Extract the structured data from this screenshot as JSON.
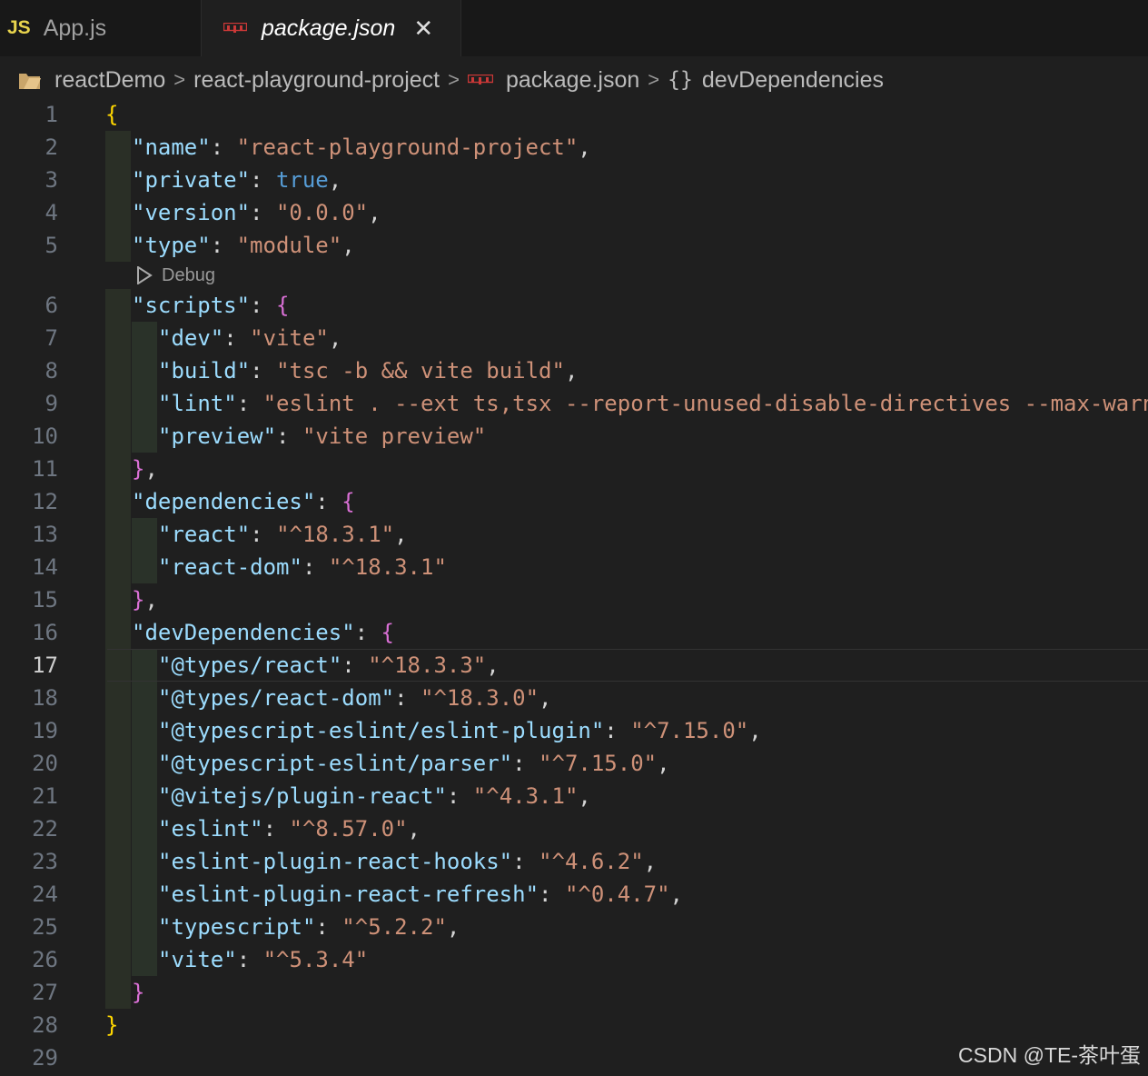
{
  "tabs": [
    {
      "badge": "JS",
      "label": "App.js"
    },
    {
      "label": "package.json",
      "close": "✕"
    }
  ],
  "breadcrumb": {
    "items": [
      "reactDemo",
      "react-playground-project",
      "package.json",
      "devDependencies"
    ],
    "separator": ">",
    "braces": "{}"
  },
  "codelens": {
    "label": "Debug"
  },
  "lines": [
    {
      "n": "1",
      "tokens": [
        [
          "br1",
          "{"
        ]
      ]
    },
    {
      "n": "2",
      "tokens": [
        [
          "k",
          "\"name\""
        ],
        [
          "p",
          ": "
        ],
        [
          "s",
          "\"react-playground-project\""
        ],
        [
          "p",
          ","
        ]
      ]
    },
    {
      "n": "3",
      "tokens": [
        [
          "k",
          "\"private\""
        ],
        [
          "p",
          ": "
        ],
        [
          "b",
          "true"
        ],
        [
          "p",
          ","
        ]
      ]
    },
    {
      "n": "4",
      "tokens": [
        [
          "k",
          "\"version\""
        ],
        [
          "p",
          ": "
        ],
        [
          "s",
          "\"0.0.0\""
        ],
        [
          "p",
          ","
        ]
      ]
    },
    {
      "n": "5",
      "tokens": [
        [
          "k",
          "\"type\""
        ],
        [
          "p",
          ": "
        ],
        [
          "s",
          "\"module\""
        ],
        [
          "p",
          ","
        ]
      ]
    },
    {
      "n": "6",
      "tokens": [
        [
          "k",
          "\"scripts\""
        ],
        [
          "p",
          ": "
        ],
        [
          "br2",
          "{"
        ]
      ]
    },
    {
      "n": "7",
      "tokens": [
        [
          "k",
          "\"dev\""
        ],
        [
          "p",
          ": "
        ],
        [
          "s",
          "\"vite\""
        ],
        [
          "p",
          ","
        ]
      ]
    },
    {
      "n": "8",
      "tokens": [
        [
          "k",
          "\"build\""
        ],
        [
          "p",
          ": "
        ],
        [
          "s",
          "\"tsc -b && vite build\""
        ],
        [
          "p",
          ","
        ]
      ]
    },
    {
      "n": "9",
      "tokens": [
        [
          "k",
          "\"lint\""
        ],
        [
          "p",
          ": "
        ],
        [
          "s",
          "\"eslint . --ext ts,tsx --report-unused-disable-directives --max-warn"
        ]
      ]
    },
    {
      "n": "10",
      "tokens": [
        [
          "k",
          "\"preview\""
        ],
        [
          "p",
          ": "
        ],
        [
          "s",
          "\"vite preview\""
        ]
      ]
    },
    {
      "n": "11",
      "tokens": [
        [
          "br2",
          "}"
        ],
        [
          "p",
          ","
        ]
      ]
    },
    {
      "n": "12",
      "tokens": [
        [
          "k",
          "\"dependencies\""
        ],
        [
          "p",
          ": "
        ],
        [
          "br2",
          "{"
        ]
      ]
    },
    {
      "n": "13",
      "tokens": [
        [
          "k",
          "\"react\""
        ],
        [
          "p",
          ": "
        ],
        [
          "s",
          "\"^18.3.1\""
        ],
        [
          "p",
          ","
        ]
      ]
    },
    {
      "n": "14",
      "tokens": [
        [
          "k",
          "\"react-dom\""
        ],
        [
          "p",
          ": "
        ],
        [
          "s",
          "\"^18.3.1\""
        ]
      ]
    },
    {
      "n": "15",
      "tokens": [
        [
          "br2",
          "}"
        ],
        [
          "p",
          ","
        ]
      ]
    },
    {
      "n": "16",
      "tokens": [
        [
          "k",
          "\"devDependencies\""
        ],
        [
          "p",
          ": "
        ],
        [
          "br2",
          "{"
        ]
      ]
    },
    {
      "n": "17",
      "tokens": [
        [
          "k",
          "\"@types/react\""
        ],
        [
          "p",
          ": "
        ],
        [
          "s",
          "\"^18.3.3\""
        ],
        [
          "p",
          ","
        ]
      ]
    },
    {
      "n": "18",
      "tokens": [
        [
          "k",
          "\"@types/react-dom\""
        ],
        [
          "p",
          ": "
        ],
        [
          "s",
          "\"^18.3.0\""
        ],
        [
          "p",
          ","
        ]
      ]
    },
    {
      "n": "19",
      "tokens": [
        [
          "k",
          "\"@typescript-eslint/eslint-plugin\""
        ],
        [
          "p",
          ": "
        ],
        [
          "s",
          "\"^7.15.0\""
        ],
        [
          "p",
          ","
        ]
      ]
    },
    {
      "n": "20",
      "tokens": [
        [
          "k",
          "\"@typescript-eslint/parser\""
        ],
        [
          "p",
          ": "
        ],
        [
          "s",
          "\"^7.15.0\""
        ],
        [
          "p",
          ","
        ]
      ]
    },
    {
      "n": "21",
      "tokens": [
        [
          "k",
          "\"@vitejs/plugin-react\""
        ],
        [
          "p",
          ": "
        ],
        [
          "s",
          "\"^4.3.1\""
        ],
        [
          "p",
          ","
        ]
      ]
    },
    {
      "n": "22",
      "tokens": [
        [
          "k",
          "\"eslint\""
        ],
        [
          "p",
          ": "
        ],
        [
          "s",
          "\"^8.57.0\""
        ],
        [
          "p",
          ","
        ]
      ]
    },
    {
      "n": "23",
      "tokens": [
        [
          "k",
          "\"eslint-plugin-react-hooks\""
        ],
        [
          "p",
          ": "
        ],
        [
          "s",
          "\"^4.6.2\""
        ],
        [
          "p",
          ","
        ]
      ]
    },
    {
      "n": "24",
      "tokens": [
        [
          "k",
          "\"eslint-plugin-react-refresh\""
        ],
        [
          "p",
          ": "
        ],
        [
          "s",
          "\"^0.4.7\""
        ],
        [
          "p",
          ","
        ]
      ]
    },
    {
      "n": "25",
      "tokens": [
        [
          "k",
          "\"typescript\""
        ],
        [
          "p",
          ": "
        ],
        [
          "s",
          "\"^5.2.2\""
        ],
        [
          "p",
          ","
        ]
      ]
    },
    {
      "n": "26",
      "tokens": [
        [
          "k",
          "\"vite\""
        ],
        [
          "p",
          ": "
        ],
        [
          "s",
          "\"^5.3.4\""
        ]
      ]
    },
    {
      "n": "27",
      "tokens": [
        [
          "br2",
          "}"
        ]
      ]
    },
    {
      "n": "28",
      "tokens": [
        [
          "br1",
          "}"
        ]
      ]
    },
    {
      "n": "29",
      "tokens": []
    }
  ],
  "active_line": "17",
  "watermark": "CSDN @TE-茶叶蛋",
  "colors": {
    "background": "#1f1f1f",
    "key": "#9cdcfe",
    "string": "#ce9178",
    "boolean": "#569cd6",
    "bracket_level1": "#ffd700",
    "bracket_level2": "#da70d6",
    "js_badge": "#e8d44d"
  }
}
